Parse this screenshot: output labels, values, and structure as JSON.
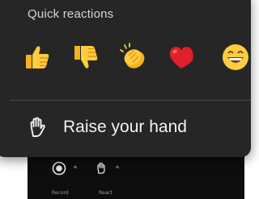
{
  "popup": {
    "title": "Quick reactions",
    "reactions": [
      {
        "icon": "thumbs-up-icon"
      },
      {
        "icon": "thumbs-down-icon"
      },
      {
        "icon": "clapping-hands-icon"
      },
      {
        "icon": "heart-icon"
      },
      {
        "icon": "grinning-face-icon"
      }
    ],
    "raise_hand_label": "Raise your hand"
  },
  "toolbar": {
    "record_label": "Record",
    "react_label": "React"
  },
  "colors": {
    "popup_bg": "#262626",
    "toolbar_bg": "#0d0d0d",
    "emoji_yellow": "#f6b21a",
    "heart_red": "#e0202a"
  }
}
